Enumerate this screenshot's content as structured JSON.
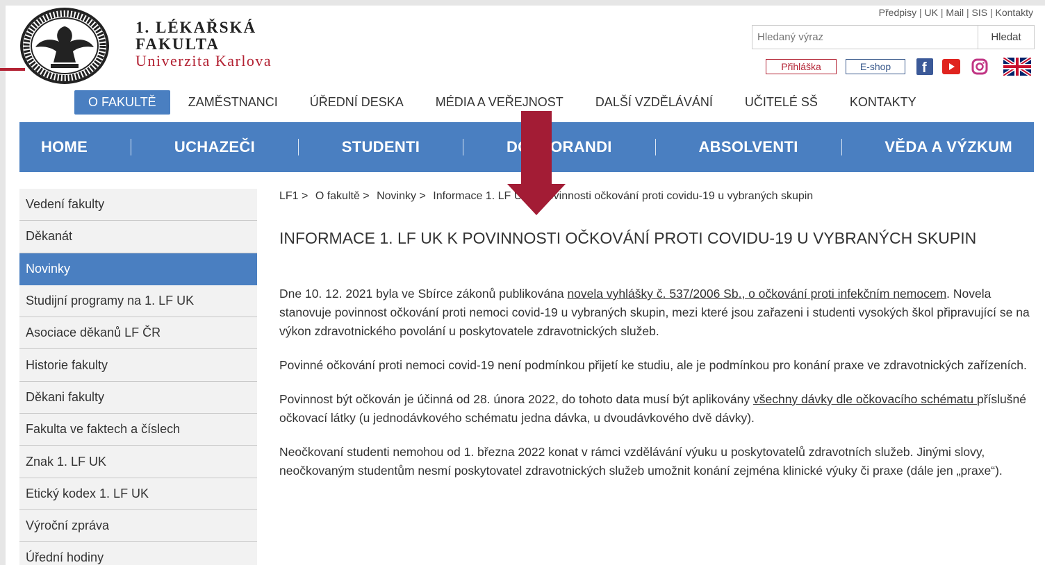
{
  "header": {
    "brand_line1": "1. LÉKAŘSKÁ",
    "brand_line2": "FAKULTA",
    "brand_line3": "Univerzita Karlova",
    "top_links": [
      "Předpisy",
      "UK",
      "Mail",
      "SIS",
      "Kontakty"
    ],
    "search_placeholder": "Hledaný výraz",
    "search_button": "Hledat",
    "login_button": "Přihláška",
    "eshop_button": "E-shop",
    "social_icons": [
      "facebook-icon",
      "youtube-icon",
      "instagram-icon",
      "english-flag-icon"
    ]
  },
  "subnav": [
    "O FAKULTĚ",
    "ZAMĚSTNANCI",
    "ÚŘEDNÍ DESKA",
    "MÉDIA A VEŘEJNOST",
    "DALŠÍ VZDĚLÁVÁNÍ",
    "UČITELÉ SŠ",
    "KONTAKTY"
  ],
  "mainnav": [
    "HOME",
    "UCHAZEČI",
    "STUDENTI",
    "DOKTORANDI",
    "ABSOLVENTI",
    "VĚDA A VÝZKUM"
  ],
  "sidebar": [
    "Vedení fakulty",
    "Děkanát",
    "Novinky",
    "Studijní programy na 1. LF UK",
    "Asociace děkanů LF ČR",
    "Historie fakulty",
    "Děkani fakulty",
    "Fakulta ve faktech a číslech",
    "Znak 1. LF UK",
    "Etický kodex 1. LF UK",
    "Výroční zpráva",
    "Úřední hodiny"
  ],
  "breadcrumb": [
    "LF1 >",
    "O fakultě >",
    "Novinky >",
    "Informace 1. LF UK k povinnosti očkování proti covidu-19 u vybraných skupin"
  ],
  "article": {
    "title": "INFORMACE 1. LF UK K POVINNOSTI OČKOVÁNÍ PROTI COVIDU-19 U VYBRANÝCH SKUPIN",
    "p1_a": "Dne 10. 12. 2021 byla ve Sbírce zákonů publikována ",
    "p1_link": "novela vyhlášky č. 537/2006 Sb., o očkování proti infekčním nemocem",
    "p1_b": ". Novela stanovuje povinnost očkování proti nemoci covid-19 u vybraných skupin, mezi které jsou zařazeni i studenti vysokých škol připravující se na výkon zdravotnického povolání u poskytovatele zdravotnických služeb.",
    "p2": "Povinné očkování proti nemoci covid-19 není podmínkou přijetí ke studiu, ale je podmínkou pro konání praxe ve zdravotnických zařízeních.",
    "p3_a": "Povinnost být očkován je účinná od 28. února 2022, do tohoto data musí být aplikovány ",
    "p3_link": "všechny dávky dle očkovacího schématu ",
    "p3_b": "příslušné očkovací látky (u jednodávkového schématu jedna dávka, u dvoudávkového dvě dávky).",
    "p4": "Neočkovaní studenti nemohou od 1. března 2022 konat v rámci vzdělávání výuku u poskytovatelů zdravotních služeb. Jinými slovy, neočkovaným studentům nesmí poskytovatel zdravotnických služeb umožnit konání zejména klinické výuky či praxe (dále jen „praxe“)."
  },
  "colors": {
    "accent_blue": "#4a7fc1",
    "brand_red": "#b32233",
    "arrow_red": "#a31c35"
  }
}
